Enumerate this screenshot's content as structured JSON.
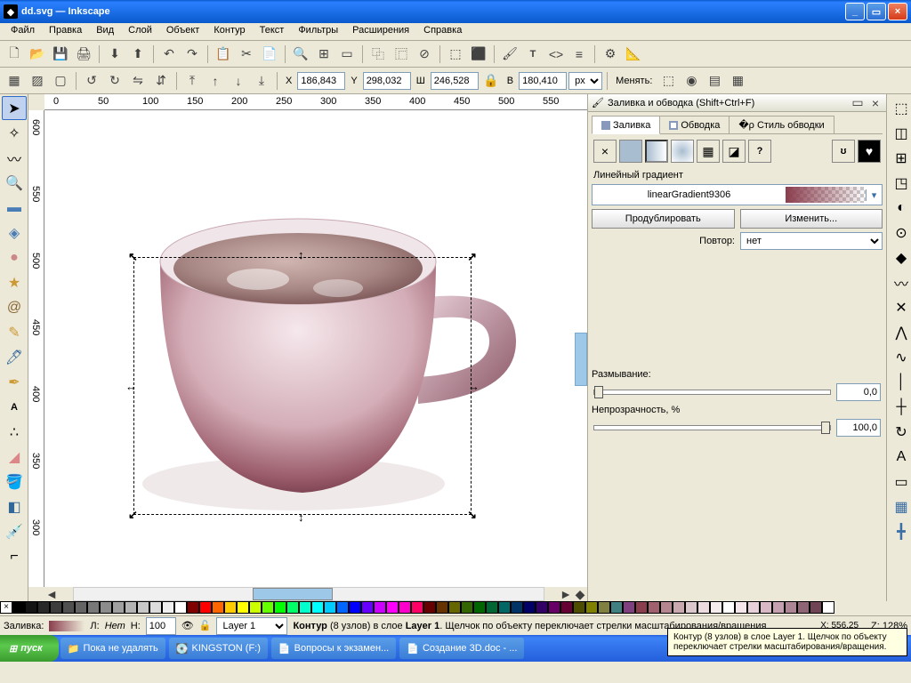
{
  "window": {
    "title": "dd.svg — Inkscape"
  },
  "menu": [
    "Файл",
    "Правка",
    "Вид",
    "Слой",
    "Объект",
    "Контур",
    "Текст",
    "Фильтры",
    "Расширения",
    "Справка"
  ],
  "options": {
    "x_label": "X",
    "x": "186,843",
    "y_label": "Y",
    "y": "298,032",
    "w_label": "Ш",
    "w": "246,528",
    "h_label": "В",
    "h": "180,410",
    "unit": "px",
    "affect": "Менять:"
  },
  "dock": {
    "title": "Заливка и обводка (Shift+Ctrl+F)",
    "tabs": {
      "fill": "Заливка",
      "stroke": "Обводка",
      "style": "Стиль обводки"
    },
    "grad_label": "Линейный градиент",
    "grad_name": "linearGradient9306",
    "dup": "Продублировать",
    "edit": "Изменить...",
    "repeat_label": "Повтор:",
    "repeat_val": "нет",
    "blur_label": "Размывание:",
    "blur": "0,0",
    "opacity_label": "Непрозрачность, %",
    "opacity": "100,0"
  },
  "status": {
    "fill_label": "Заливка:",
    "stroke_label": "Л:",
    "stroke_val": "Нет",
    "opacity_label": "Н:",
    "opacity": "100",
    "layer": "Layer 1",
    "msg_pre": "Контур",
    "msg_nodes": "(8 узлов) в слое",
    "msg_layer": "Layer 1",
    "msg_tail": ". Щелчок по объекту переключает стрелки масштабирования/вращения",
    "coords": "X:   556,25",
    "zoom": "Z:   128%"
  },
  "tooltip": "Контур (8 узлов) в слое Layer 1. Щелчок по объекту переключает стрелки масштабирования/вращения.",
  "taskbar": {
    "start": "пуск",
    "items": [
      "Пока не удалять",
      "KINGSTON (F:)",
      "Вопросы к экзамен...",
      "Создание 3D.doc - ..."
    ]
  },
  "ruler_h": [
    "0",
    "50",
    "100",
    "150",
    "200",
    "250",
    "300",
    "350",
    "400",
    "450",
    "500",
    "550"
  ],
  "ruler_v": [
    "600",
    "550",
    "500",
    "450",
    "400",
    "350",
    "300"
  ],
  "palette": [
    "#000000",
    "#141414",
    "#282828",
    "#3c3c3c",
    "#505050",
    "#646464",
    "#787878",
    "#8c8c8c",
    "#a0a0a0",
    "#b4b4b4",
    "#c8c8c8",
    "#dcdcdc",
    "#f0f0f0",
    "#ffffff",
    "#800000",
    "#ff0000",
    "#ff6600",
    "#ffcc00",
    "#ffff00",
    "#ccff00",
    "#66ff00",
    "#00ff00",
    "#00ff66",
    "#00ffcc",
    "#00ffff",
    "#00ccff",
    "#0066ff",
    "#0000ff",
    "#6600ff",
    "#cc00ff",
    "#ff00ff",
    "#ff00cc",
    "#ff0066",
    "#660000",
    "#663300",
    "#666600",
    "#336600",
    "#006600",
    "#006633",
    "#006666",
    "#003366",
    "#000066",
    "#330066",
    "#660066",
    "#660033",
    "#4d4d00",
    "#808000",
    "#808040",
    "#408080",
    "#804080",
    "#8a3d4d",
    "#a0606d",
    "#b58590",
    "#c9a8b0",
    "#dbc8cd",
    "#ecdbdf",
    "#f5eced",
    "#ffffff",
    "#f5e6ec",
    "#e8d0da",
    "#d8b8c5",
    "#c5a0b0",
    "#ad8595",
    "#8f6575",
    "#6f4555",
    "#ffffff"
  ]
}
